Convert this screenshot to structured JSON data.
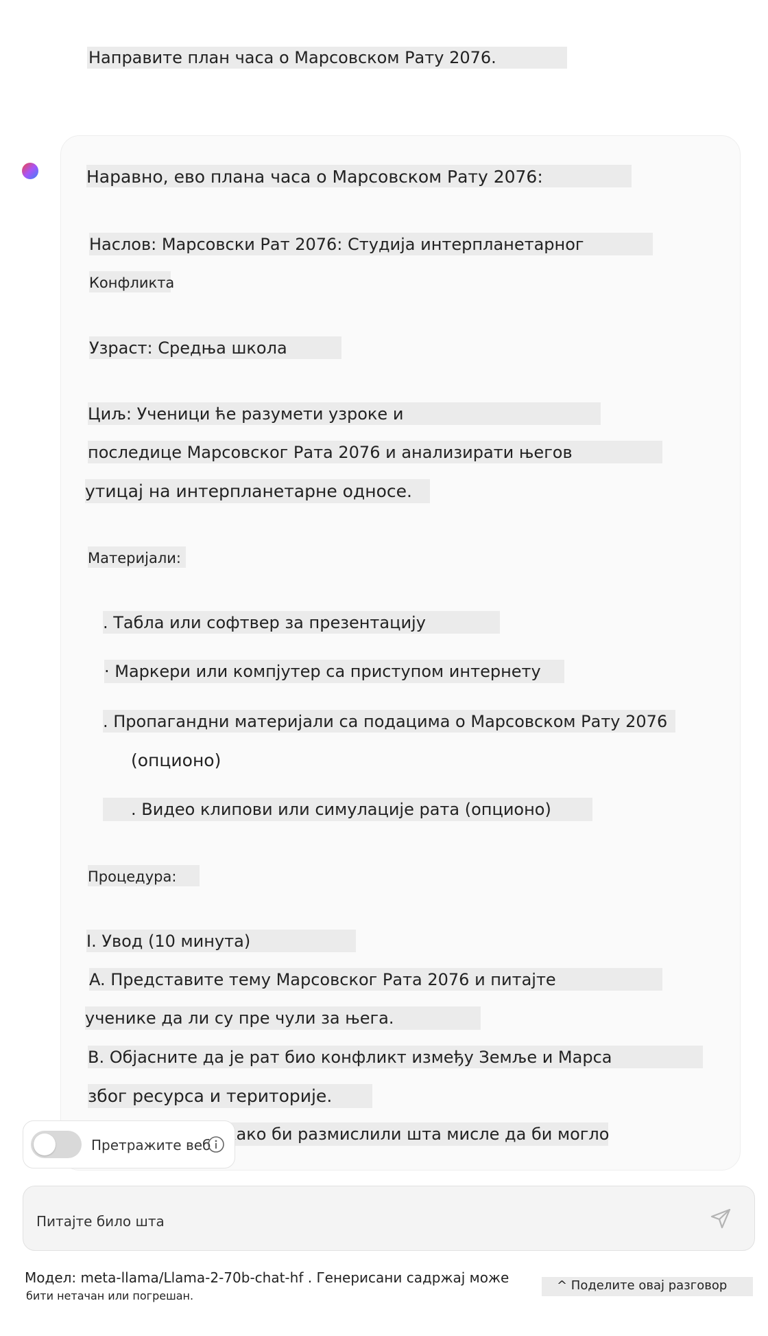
{
  "conversation": {
    "user_message": "Направите план часа о Марсовском Рату 2076.",
    "assistant": {
      "intro": "Наравно, ево плана часа о Марсовском Рату 2076:",
      "title_line1": "Наслов: Марсовски Рат 2076: Студија интерпланетарног",
      "title_line2": "Конфликта",
      "age": "Узраст: Средња школа",
      "goal_line1": "Циљ: Ученици ће разумети узроке и",
      "goal_line2": "последице Марсовског Рата 2076 и анализирати његов",
      "goal_line3": "утицај на интерпланетарне односе.",
      "materials_heading": "Материјали:",
      "material_1": ". Табла или софтвер за презентацију",
      "material_2": "· Маркери или компјутер са приступом интернету",
      "material_3_line1": ". Пропагандни материјали са подацима о Марсовском Рату 2076",
      "material_3_line2": "(опционо)",
      "material_4": ". Видео клипови или симулације рата (опционо)",
      "procedure_heading": "Процедура:",
      "procedure_1": "I. Увод (10 минута)",
      "procedure_a_line1": "A. Представите тему Марсовског Рата 2076 и питајте",
      "procedure_a_line2": "ученике да ли су пре чули за њега.",
      "procedure_b_line1": "B. Објасните да је рат био конфликт између Земље и Марса",
      "procedure_b_line2": "због ресурса и територије.",
      "procedure_c_partial": "како би размислили шта мисле да би могло"
    }
  },
  "web_search": {
    "label": "Претражите веб",
    "enabled": false
  },
  "prompt": {
    "placeholder": "Питајте било шта"
  },
  "footer": {
    "disclaimer_line1": "Модел: meta-llama/Llama-2-70b-chat-hf . Генерисани садржај може",
    "disclaimer_line2": "бити нетачан или погрешан.",
    "share_label": "^ Поделите овај разговор"
  },
  "icons": {
    "assistant_avatar": "gradient-avatar-icon",
    "info": "info-icon",
    "send": "send-icon"
  },
  "colors": {
    "highlight": "#ebebeb",
    "card_background": "#fafafa",
    "toggle_off": "#d9d9d9"
  }
}
